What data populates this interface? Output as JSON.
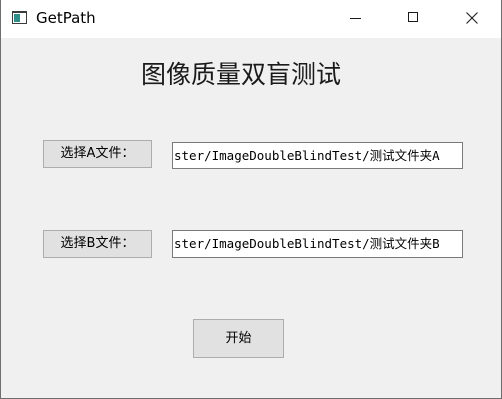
{
  "window": {
    "title": "GetPath",
    "icon": "app-window-icon",
    "controls": [
      "minimize-icon",
      "maximize-icon",
      "close-icon"
    ]
  },
  "main": {
    "heading": "图像质量双盲测试",
    "select_a_label": "选择A文件：",
    "path_a_value": "ster/ImageDoubleBlindTest/测试文件夹A",
    "select_b_label": "选择B文件：",
    "path_b_value": "ster/ImageDoubleBlindTest/测试文件夹B",
    "start_label": "开始"
  }
}
